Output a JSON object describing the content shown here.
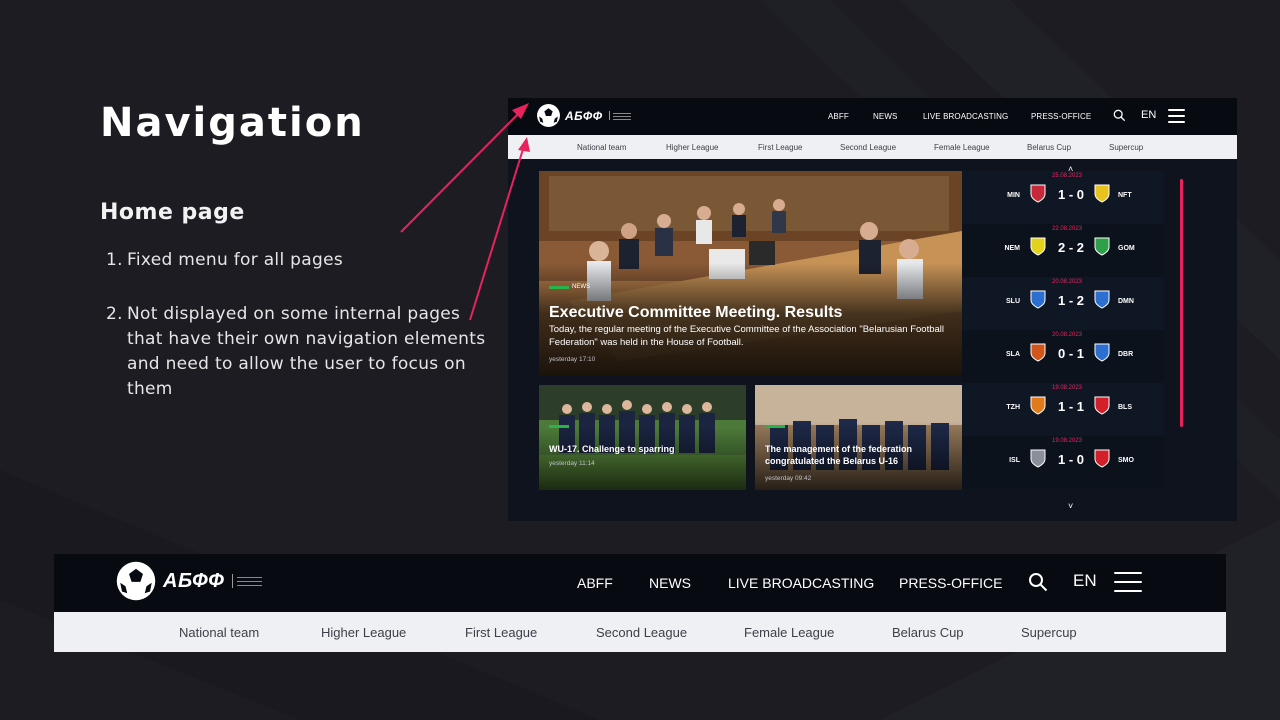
{
  "slide": {
    "title": "Navigation",
    "subtitle": "Home page",
    "notes": [
      {
        "num": "1.",
        "text": "Fixed menu for all pages"
      },
      {
        "num": "2.",
        "text": "Not displayed on some internal pages that have their own navigation elements and need to allow the user to focus on them"
      }
    ]
  },
  "site": {
    "logo_text": "АБФФ",
    "nav": [
      "ABFF",
      "NEWS",
      "LIVE BROADCASTING",
      "PRESS-OFFICE"
    ],
    "lang": "EN",
    "subnav": [
      "National team",
      "Higher League",
      "First League",
      "Second League",
      "Female League",
      "Belarus Cup",
      "Supercup"
    ],
    "main_news": {
      "tag": "NEWS",
      "title": "Executive Committee Meeting. Results",
      "description": "Today, the regular meeting of the Executive Committee of the Association \"Belarusian Football Federation\" was held in the House of Football.",
      "date": "yesterday 17:10"
    },
    "small_news": [
      {
        "title": "WU-17. Challenge to sparring",
        "date": "yesterday 11:14"
      },
      {
        "title": "The management of the federation congratulated the Belarus U-16",
        "date": "yesterday 09:42"
      }
    ],
    "matches": [
      {
        "date": "25.08.2023",
        "home": "MIN",
        "score": "1 - 0",
        "away": "NFT",
        "home_color": "#c62a3a",
        "away_color": "#e8c21e"
      },
      {
        "date": "22.08.2023",
        "home": "NEM",
        "score": "2 - 2",
        "away": "GOM",
        "home_color": "#e3d21a",
        "away_color": "#2ea04a"
      },
      {
        "date": "20.08.2023",
        "home": "SLU",
        "score": "1 - 2",
        "away": "DMN",
        "home_color": "#2d6fd1",
        "away_color": "#2d6fd1"
      },
      {
        "date": "20.08.2023",
        "home": "SLA",
        "score": "0 - 1",
        "away": "DBR",
        "home_color": "#d2561c",
        "away_color": "#2d6fd1"
      },
      {
        "date": "19.08.2023",
        "home": "TZH",
        "score": "1 - 1",
        "away": "BLS",
        "home_color": "#e07a1a",
        "away_color": "#d21f2a"
      },
      {
        "date": "19.08.2023",
        "home": "ISL",
        "score": "1 - 0",
        "away": "SMO",
        "home_color": "#8a8f99",
        "away_color": "#d21f2a"
      }
    ]
  },
  "colors": {
    "accent": "#e7235e",
    "background": "#1c1c22",
    "header": "#070a11",
    "subbar": "#eef0f3",
    "news_tag": "#29b34a"
  },
  "icons": {
    "logo": "abff-ball-logo",
    "search": "search-icon",
    "menu": "hamburger-menu-icon",
    "scroll_up": "chevron-up-icon",
    "scroll_down": "chevron-down-icon"
  }
}
